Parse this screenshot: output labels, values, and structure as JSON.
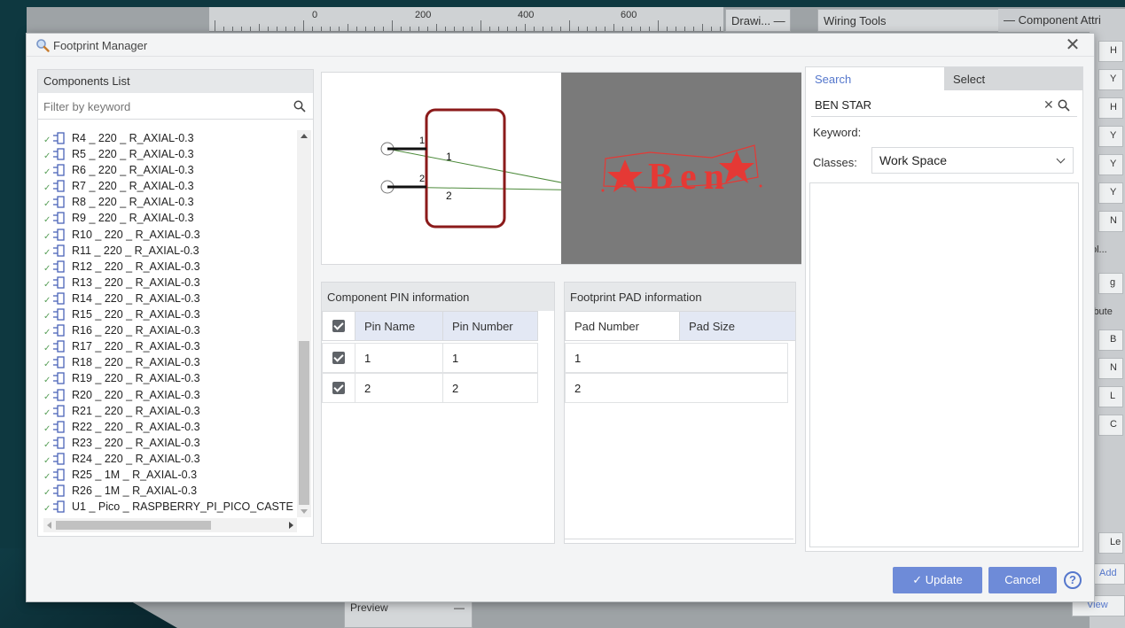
{
  "background": {
    "ruler_numbers": [
      "0",
      "200",
      "400",
      "600"
    ],
    "drawing_panel_title": "Drawi...",
    "wiring_panel_title": "Wiring Tools",
    "component_attr_title": "Component Attri",
    "preview_panel_title": "Preview",
    "right_buttons": [
      "H",
      "Y",
      "H",
      "Y",
      "Y",
      "Y",
      "N",
      "ol...",
      "g",
      "ibute",
      "B",
      "N",
      "L",
      "C",
      "Le",
      "Add",
      "View"
    ]
  },
  "dialog": {
    "title": "Footprint Manager",
    "close_symbol": "✕"
  },
  "components_list": {
    "header": "Components List",
    "filter_placeholder": "Filter by keyword",
    "items": [
      "R4 _ 220 _ R_AXIAL-0.3",
      "R5 _ 220 _ R_AXIAL-0.3",
      "R6 _ 220 _ R_AXIAL-0.3",
      "R7 _ 220 _ R_AXIAL-0.3",
      "R8 _ 220 _ R_AXIAL-0.3",
      "R9 _ 220 _ R_AXIAL-0.3",
      "R10 _ 220 _ R_AXIAL-0.3",
      "R11 _ 220 _ R_AXIAL-0.3",
      "R12 _ 220 _ R_AXIAL-0.3",
      "R13 _ 220 _ R_AXIAL-0.3",
      "R14 _ 220 _ R_AXIAL-0.3",
      "R15 _ 220 _ R_AXIAL-0.3",
      "R16 _ 220 _ R_AXIAL-0.3",
      "R17 _ 220 _ R_AXIAL-0.3",
      "R18 _ 220 _ R_AXIAL-0.3",
      "R19 _ 220 _ R_AXIAL-0.3",
      "R20 _ 220 _ R_AXIAL-0.3",
      "R21 _ 220 _ R_AXIAL-0.3",
      "R22 _ 220 _ R_AXIAL-0.3",
      "R23 _ 220 _ R_AXIAL-0.3",
      "R24 _ 220 _ R_AXIAL-0.3",
      "R25 _ 1M _ R_AXIAL-0.3",
      "R26 _ 1M _ R_AXIAL-0.3",
      "U1 _ Pico _ RASPBERRY_PI_PICO_CASTE"
    ]
  },
  "preview": {
    "symbol_pins": [
      "1",
      "2"
    ],
    "symbol_pin_labels": [
      "1",
      "2"
    ],
    "footprint_text": "Ben",
    "footprint_bg": "#7a7a7a",
    "footprint_color": "#e53935"
  },
  "pin_info": {
    "header": "Component PIN information",
    "col_name": "Pin Name",
    "col_number": "Pin Number",
    "rows": [
      {
        "name": "1",
        "number": "1"
      },
      {
        "name": "2",
        "number": "2"
      }
    ]
  },
  "pad_info": {
    "header": "Footprint PAD information",
    "col_number": "Pad Number",
    "col_size": "Pad Size",
    "rows": [
      "1",
      "2"
    ]
  },
  "search": {
    "tab_search": "Search",
    "tab_select": "Select",
    "value": "BEN STAR",
    "keyword_label": "Keyword:",
    "classes_label": "Classes:",
    "classes_value": "Work Space"
  },
  "footer": {
    "update_label": "Update",
    "cancel_label": "Cancel",
    "help_label": "?"
  },
  "colors": {
    "accent": "#6e8bd8",
    "tab_active": "#5577cc",
    "symbol_outline": "#8b1a1a",
    "ratsnest": "#4c8a3a"
  }
}
